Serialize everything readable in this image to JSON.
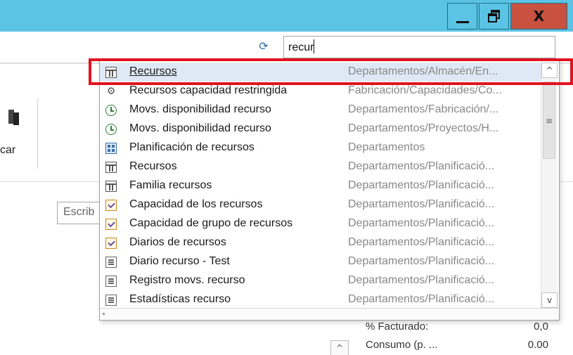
{
  "window": {
    "minimize_label": "_",
    "close_label": "X"
  },
  "toolbar": {
    "refresh_icon": "refresh-icon",
    "search_value": "recur"
  },
  "background": {
    "ribbon_label": "car",
    "input_placeholder_partial": "Escrib",
    "fields": [
      {
        "label": "% Facturado:",
        "value": "0,0"
      },
      {
        "label": "Consumo (p. ...",
        "value": "0.00"
      }
    ],
    "mini_button_glyph": "^"
  },
  "dropdown": {
    "items": [
      {
        "icon": "table",
        "name": "Recursos",
        "path": "Departamentos/Almacén/En...",
        "selected": true
      },
      {
        "icon": "gear",
        "name": "Recursos capacidad restringida",
        "path": "Fabricación/Capacidades/Co..."
      },
      {
        "icon": "history",
        "name": "Movs. disponibilidad recurso",
        "path": "Departamentos/Fabricación/..."
      },
      {
        "icon": "history",
        "name": "Movs. disponibilidad recurso",
        "path": "Departamentos/Proyectos/H..."
      },
      {
        "icon": "plan",
        "name": "Planificación de recursos",
        "path": "Departamentos"
      },
      {
        "icon": "table",
        "name": "Recursos",
        "path": "Departamentos/Planificació..."
      },
      {
        "icon": "table",
        "name": "Familia recursos",
        "path": "Departamentos/Planificació..."
      },
      {
        "icon": "check",
        "name": "Capacidad de los recursos",
        "path": "Departamentos/Planificació..."
      },
      {
        "icon": "check",
        "name": "Capacidad de grupo de recursos",
        "path": "Departamentos/Planificació..."
      },
      {
        "icon": "check",
        "name": "Diarios de recursos",
        "path": "Departamentos/Planificació..."
      },
      {
        "icon": "doc",
        "name": "Diario recurso - Test",
        "path": "Departamentos/Planificació..."
      },
      {
        "icon": "doc",
        "name": "Registro movs. recurso",
        "path": "Departamentos/Planificació..."
      },
      {
        "icon": "doc",
        "name": "Estadísticas recurso",
        "path": "Departamentos/Planificació..."
      }
    ],
    "scroll_up": "^",
    "scroll_down": "v",
    "thumb_grip": "≡"
  },
  "colors": {
    "titlebar": "#5bc3e3",
    "close_button": "#c8513f",
    "highlight": "#e0141e",
    "selection": "#dfe9f5"
  }
}
